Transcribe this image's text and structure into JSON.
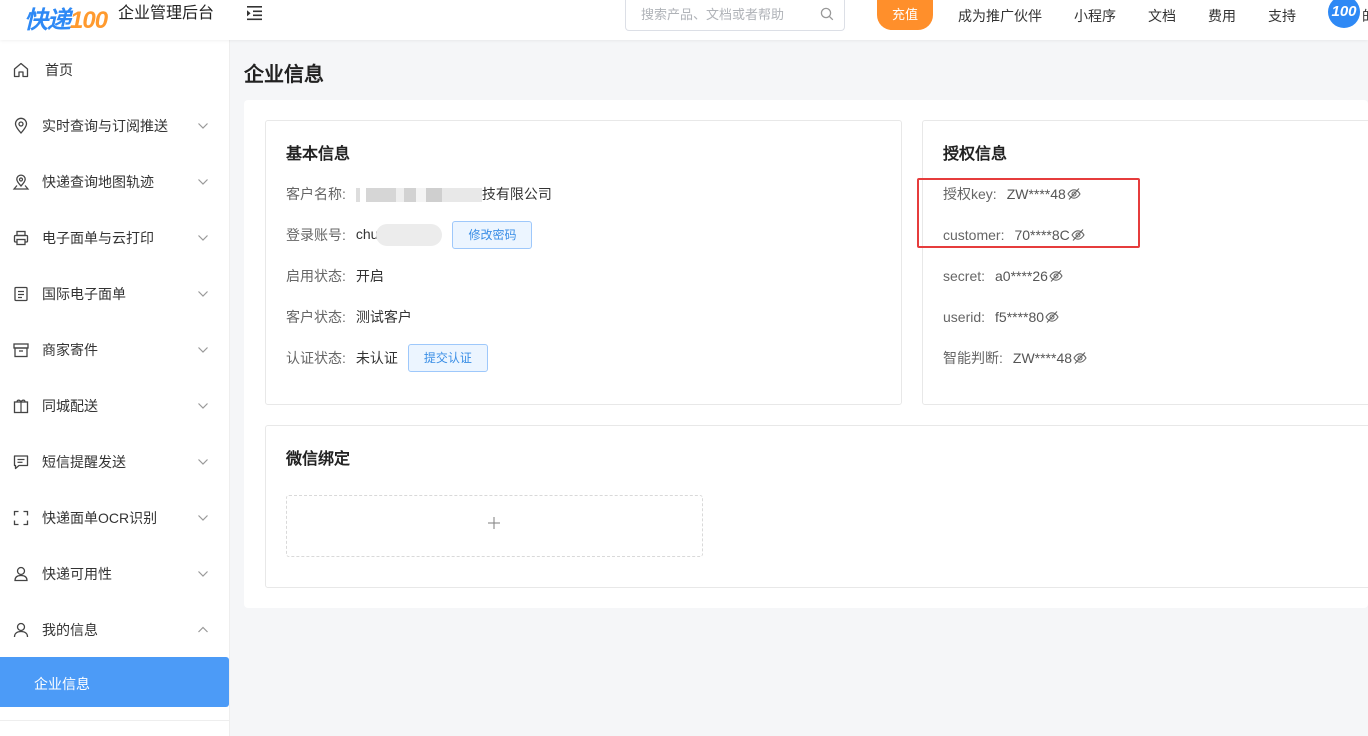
{
  "header": {
    "brand": "快递",
    "brand_num": "100",
    "app_title": "企业管理后台",
    "search_placeholder": "搜索产品、文档或者帮助",
    "recharge_label": "充值",
    "nav": [
      "成为推广伙伴",
      "小程序",
      "文档",
      "费用",
      "支持"
    ],
    "avatar_text": "100",
    "avatar_ext": "的"
  },
  "sidebar": {
    "items": [
      {
        "label": "首页",
        "icon": "home-icon"
      },
      {
        "label": "实时查询与订阅推送",
        "icon": "location-pin-icon"
      },
      {
        "label": "快递查询地图轨迹",
        "icon": "map-pin-icon"
      },
      {
        "label": "电子面单与云打印",
        "icon": "printer-icon"
      },
      {
        "label": "国际电子面单",
        "icon": "document-icon"
      },
      {
        "label": "商家寄件",
        "icon": "box-icon"
      },
      {
        "label": "同城配送",
        "icon": "package-icon"
      },
      {
        "label": "短信提醒发送",
        "icon": "message-icon"
      },
      {
        "label": "快递面单OCR识别",
        "icon": "scan-icon"
      },
      {
        "label": "快递可用性",
        "icon": "person-pin-icon"
      },
      {
        "label": "我的信息",
        "icon": "user-icon"
      }
    ],
    "active_sub": "企业信息"
  },
  "page": {
    "title": "企业信息"
  },
  "basic_info": {
    "title": "基本信息",
    "customer_name_label": "客户名称:",
    "customer_name_suffix": "技有限公司",
    "login_label": "登录账号:",
    "login_prefix": "chu",
    "change_password": "修改密码",
    "enable_label": "启用状态:",
    "enable_value": "开启",
    "customer_status_label": "客户状态:",
    "customer_status_value": "测试客户",
    "cert_label": "认证状态:",
    "cert_value": "未认证",
    "submit_cert": "提交认证"
  },
  "auth_info": {
    "title": "授权信息",
    "rows": [
      {
        "label": "授权key:",
        "value": "ZW****48"
      },
      {
        "label": "customer:",
        "value": "70****8C"
      },
      {
        "label": "secret:",
        "value": "a0****26"
      },
      {
        "label": "userid:",
        "value": "f5****80"
      },
      {
        "label": "智能判断:",
        "value": "ZW****48"
      }
    ]
  },
  "wechat": {
    "title": "微信绑定"
  },
  "colors": {
    "accent": "#4c9bf7",
    "recharge": "#ff8f2b",
    "highlight": "#e63c3c"
  }
}
